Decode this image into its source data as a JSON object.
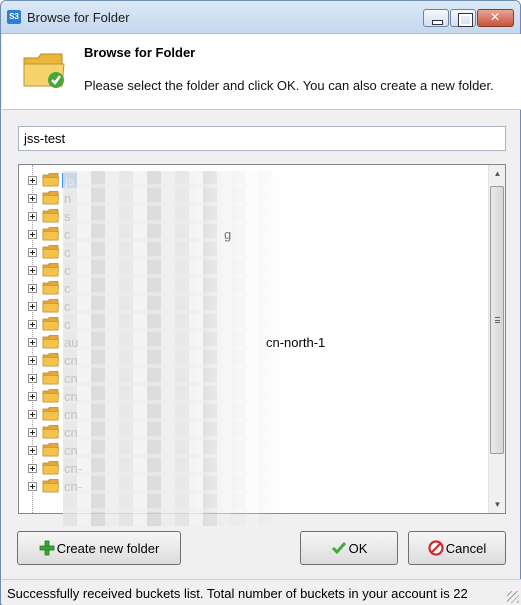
{
  "window": {
    "app_icon_text": "S3",
    "title": "Browse for Folder"
  },
  "header": {
    "title": "Browse for Folder",
    "description": "Please select the folder and click OK. You can also create a new folder."
  },
  "path_field": {
    "value": "jss-test"
  },
  "tree": {
    "items": [
      {
        "label": "js",
        "selected": true
      },
      {
        "label": "n"
      },
      {
        "label": "s"
      },
      {
        "label": "c"
      },
      {
        "label": "c"
      },
      {
        "label": "c"
      },
      {
        "label": "c"
      },
      {
        "label": "c"
      },
      {
        "label": "c"
      },
      {
        "label": "au"
      },
      {
        "label": "cn"
      },
      {
        "label": "cn"
      },
      {
        "label": "cn"
      },
      {
        "label": "cn"
      },
      {
        "label": "cn"
      },
      {
        "label": "cn"
      },
      {
        "label": "cn-"
      },
      {
        "label": "cn-"
      }
    ],
    "partial_suffix_row10": "cn-north-1",
    "partial_suffix_row4": "g"
  },
  "buttons": {
    "create": "Create new folder",
    "ok": "OK",
    "cancel": "Cancel"
  },
  "status": {
    "text": "Successfully received buckets list. Total number of buckets in your account is 22"
  },
  "colors": {
    "selection": "#3399ff",
    "folder": "#f5c24c",
    "title_bar": "#c4d8ee"
  }
}
